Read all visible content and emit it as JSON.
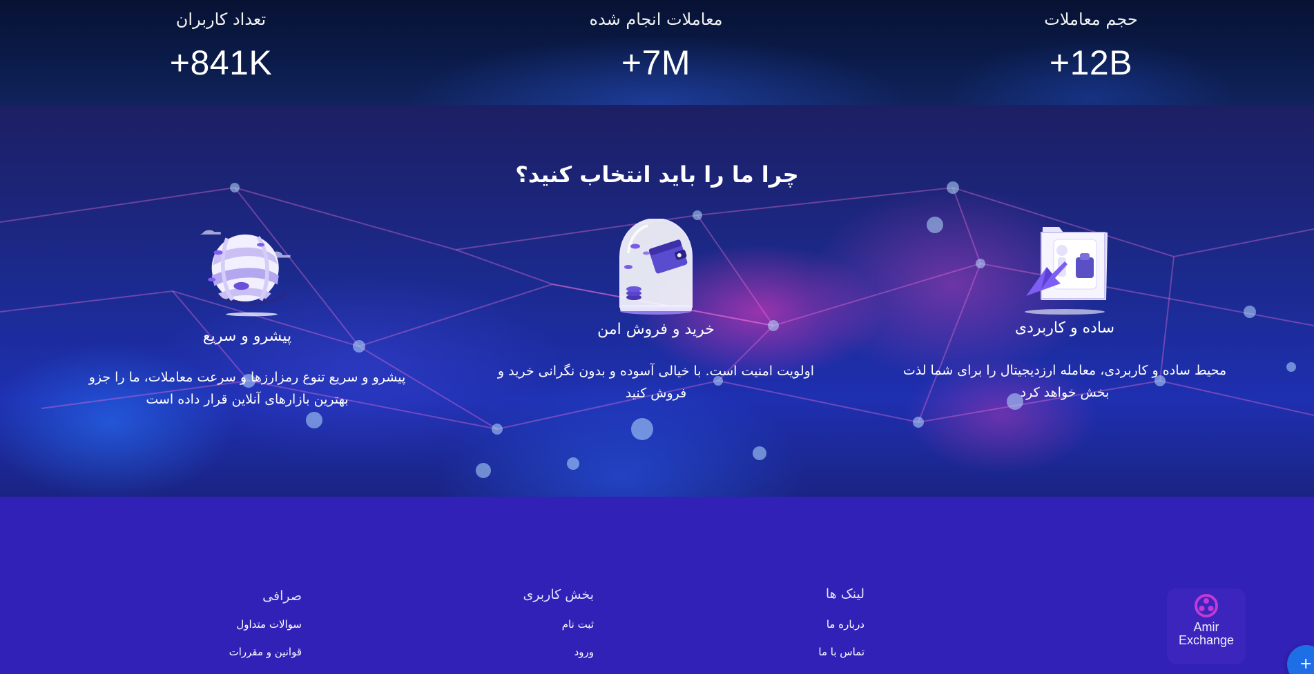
{
  "stats": [
    {
      "label": "حجم معاملات",
      "value": "+12B"
    },
    {
      "label": "معاملات انجام شده",
      "value": "+7M"
    },
    {
      "label": "تعداد کاربران",
      "value": "+841K"
    }
  ],
  "why_us": {
    "heading": "چرا ما را باید انتخاب کنید؟",
    "features": [
      {
        "title": "ساده و کاربردی",
        "desc_line1": "محیط ساده و کاربردی، معامله ارزدیجیتال را برای شما لذت",
        "desc_line2": "بخش خواهد کرد",
        "icon": "folder-cursor-illustration"
      },
      {
        "title": "خرید و فروش امن",
        "desc_line1": "اولویت امنیت است. با خیالی آسوده و بدون نگرانی خرید و",
        "desc_line2": "فروش کنید",
        "icon": "wallet-dome-illustration"
      },
      {
        "title": "پیشرو و سریع",
        "desc_line1": "پیشرو و سریع تنوع رمزارزها و سرعت معاملات، ما را جزو",
        "desc_line2": "بهترین بازارهای آنلاین قرار داده است",
        "icon": "globe-coins-illustration"
      }
    ]
  },
  "footer": {
    "columns": [
      {
        "title": "لینک ها",
        "links": [
          "درباره ما",
          "تماس با ما"
        ]
      },
      {
        "title": "بخش کاربری",
        "links": [
          "ثبت نام",
          "ورود"
        ]
      },
      {
        "title": "صرافی",
        "links": [
          "سوالات متداول",
          "قوانین و مقررات"
        ]
      }
    ],
    "brand": {
      "line1": "Amir",
      "line2": "Exchange",
      "icon": "amir-exchange-logo-icon"
    }
  },
  "fab": {
    "label": "+",
    "icon": "plus-icon"
  },
  "colors": {
    "footer_bg": "#3221b6",
    "stats_bg": "#0b1b4a",
    "fab_bg": "#1e6fe6",
    "brand_accent": "#c23ad6"
  }
}
